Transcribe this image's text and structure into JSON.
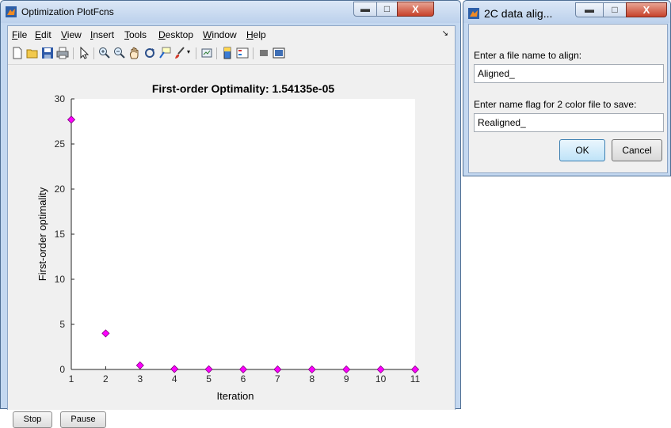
{
  "figure_window": {
    "title": "Optimization PlotFcns",
    "menu": [
      {
        "pre": "",
        "accel": "F",
        "post": "ile"
      },
      {
        "pre": "",
        "accel": "E",
        "post": "dit"
      },
      {
        "pre": "",
        "accel": "V",
        "post": "iew"
      },
      {
        "pre": "",
        "accel": "I",
        "post": "nsert"
      },
      {
        "pre": "",
        "accel": "T",
        "post": "ools"
      },
      {
        "pre": "",
        "accel": "D",
        "post": "esktop"
      },
      {
        "pre": "",
        "accel": "W",
        "post": "indow"
      },
      {
        "pre": "",
        "accel": "H",
        "post": "elp"
      }
    ],
    "toolbar_icons": [
      "new-figure-icon",
      "open-file-icon",
      "save-icon",
      "print-icon",
      "pointer-icon",
      "zoom-in-icon",
      "zoom-out-icon",
      "pan-icon",
      "rotate-3d-icon",
      "data-cursor-icon",
      "brush-icon",
      "link-plot-icon",
      "colorbar-icon",
      "legend-icon",
      "hide-plot-tools-icon",
      "show-plot-tools-icon"
    ],
    "buttons": {
      "stop": "Stop",
      "pause": "Pause"
    }
  },
  "chart_data": {
    "type": "scatter",
    "title": "First-order Optimality: 1.54135e-05",
    "xlabel": "Iteration",
    "ylabel": "First-order optimality",
    "xlim": [
      1,
      11
    ],
    "ylim": [
      0,
      30
    ],
    "xticks": [
      1,
      2,
      3,
      4,
      5,
      6,
      7,
      8,
      9,
      10,
      11
    ],
    "yticks": [
      0,
      5,
      10,
      15,
      20,
      25,
      30
    ],
    "grid": false,
    "marker": "diamond",
    "marker_color": "#ff00ff",
    "series": [
      {
        "x": [
          1,
          2,
          3,
          4,
          5,
          6,
          7,
          8,
          9,
          10,
          11
        ],
        "y": [
          27.7,
          4.0,
          0.45,
          0.05,
          0.02,
          0.01,
          0.005,
          0.002,
          0.001,
          0.0005,
          1.54e-05
        ]
      }
    ]
  },
  "dialog": {
    "title": "2C data alig...",
    "prompt1": "Enter a file name to align:",
    "value1": "Aligned_",
    "prompt2": "Enter name flag for 2 color file to save:",
    "value2": "Realigned_",
    "ok": "OK",
    "cancel": "Cancel"
  }
}
